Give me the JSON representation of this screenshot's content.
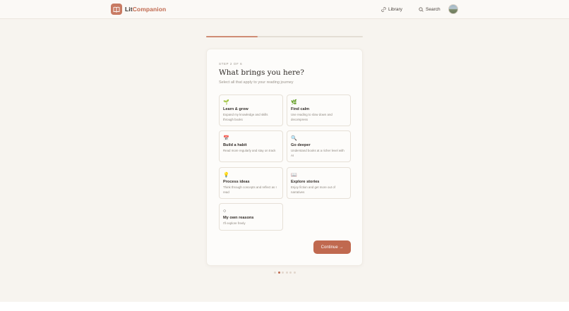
{
  "app": {
    "brand_part1": "Lit",
    "brand_part2": "Companion",
    "brand_color": "#c0694f"
  },
  "header": {
    "library_label": "Library",
    "search_label": "Search"
  },
  "progress": {
    "value": 0.33
  },
  "onboarding": {
    "step_label": "STEP 2 OF 6",
    "title": "What brings you here?",
    "subtitle": "Select all that apply to your reading journey",
    "options": [
      {
        "icon_name": "seedling-icon",
        "icon": "🌱",
        "title": "Learn & grow",
        "description": "Expand my knowledge and skills through books"
      },
      {
        "icon_name": "leaf-icon",
        "icon": "🌿",
        "title": "Find calm",
        "description": "Use reading to slow down and decompress"
      },
      {
        "icon_name": "calendar-icon",
        "icon": "📅",
        "title": "Build a habit",
        "description": "Read more regularly and stay on track"
      },
      {
        "icon_name": "magnifier-icon",
        "icon": "🔍",
        "title": "Go deeper",
        "description": "Understand books at a richer level with AI"
      },
      {
        "icon_name": "lightbulb-icon",
        "icon": "💡",
        "title": "Process ideas",
        "description": "Think through concepts and reflect as I read"
      },
      {
        "icon_name": "open-book-icon",
        "icon": "📖",
        "title": "Explore stories",
        "description": "Enjoy fiction and get more out of narratives"
      },
      {
        "icon_name": "circle-icon",
        "icon": "○",
        "title": "My own reasons",
        "description": "I'll explore freely"
      }
    ],
    "continue_label": "Continue →"
  },
  "pagination": {
    "total": 6,
    "current": 2
  }
}
